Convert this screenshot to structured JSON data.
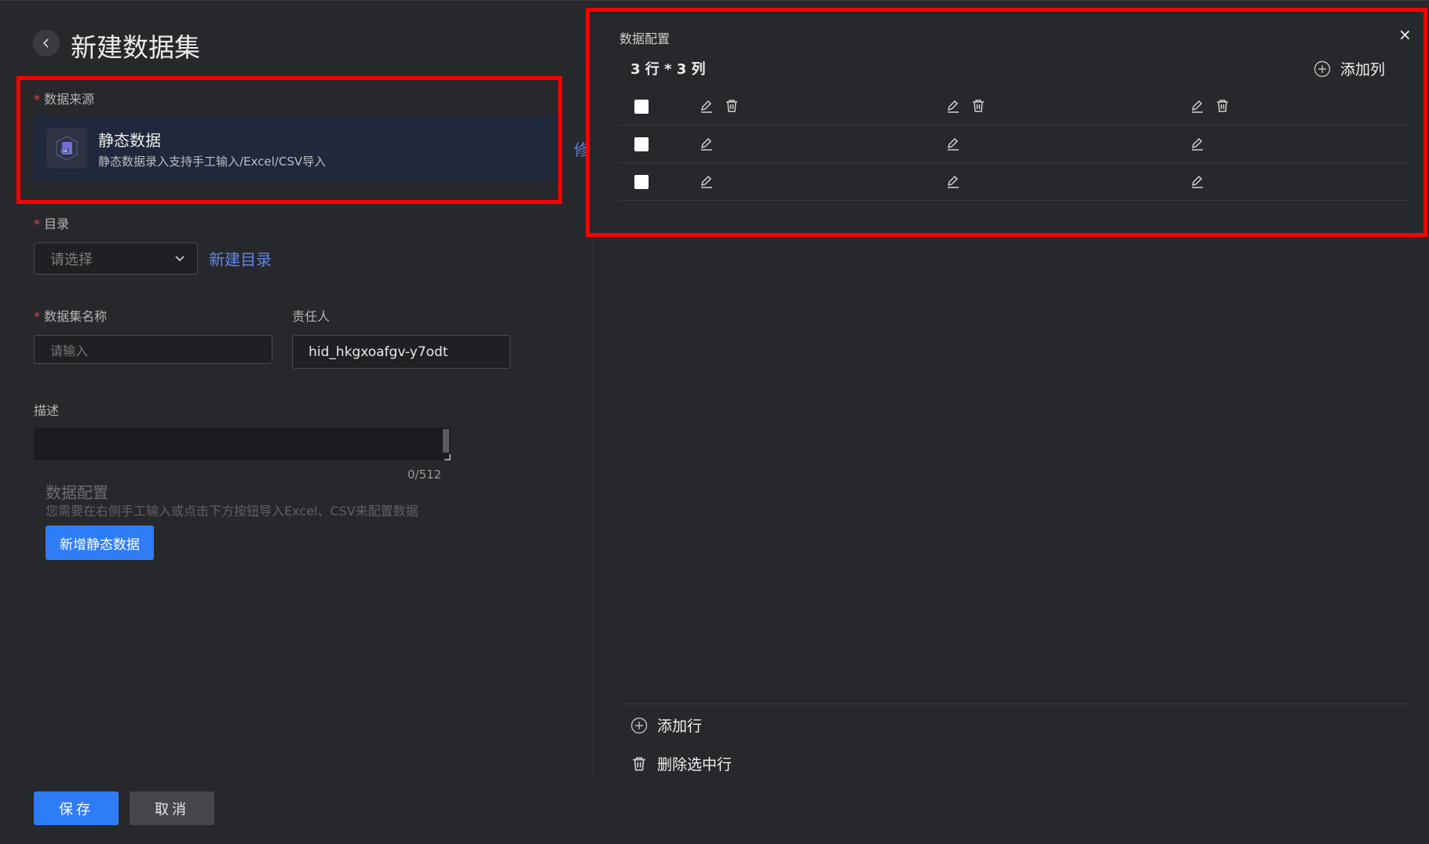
{
  "page": {
    "title": "新建数据集"
  },
  "form": {
    "source_label": "数据来源",
    "source": {
      "title": "静态数据",
      "description": "静态数据录入支持手工输入/Excel/CSV导入",
      "modify_link": "修"
    },
    "dir_label": "目录",
    "dir_placeholder": "请选择",
    "new_dir_link": "新建目录",
    "name_label": "数据集名称",
    "name_placeholder": "请输入",
    "owner_label": "责任人",
    "owner_value": "hid_hkgxoafgv-y7odt",
    "desc_label": "描述",
    "desc_counter": "0/512",
    "config_title": "数据配置",
    "config_hint": "您需要在右侧手工输入或点击下方按钮导入Excel、CSV来配置数据",
    "add_static_button": "新增静态数据"
  },
  "footer": {
    "save": "保存",
    "cancel": "取消"
  },
  "panel": {
    "title": "数据配置",
    "close": "×",
    "dims": "3 行 * 3 列",
    "add_column": "添加列",
    "rows": 3,
    "columns": 3,
    "add_row": "添加行",
    "delete_selected": "删除选中行"
  },
  "colors": {
    "accent": "#2f7cf7",
    "link": "#5f86e6",
    "highlight": "#ff0000",
    "background": "#27282c"
  },
  "icons": [
    "back-icon",
    "static-data-icon",
    "chevron-down-icon",
    "close-icon",
    "add-circle-icon",
    "edit-icon",
    "trash-icon"
  ]
}
